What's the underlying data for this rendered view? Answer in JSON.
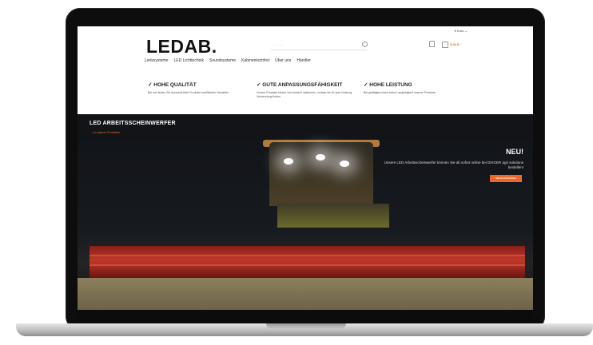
{
  "header": {
    "language": "€ Euro ⌄",
    "logo": "LEDAB.",
    "search_placeholder": "…………",
    "cart_total": "0,00 €*"
  },
  "nav": {
    "items": [
      "Lenksysteme",
      "LED Lichttechnik",
      "Soundsysteme",
      "Kabinenkomfort",
      "Über uns",
      "Händler"
    ]
  },
  "features": [
    {
      "title": "✓ HOHE QUALITÄT",
      "text": "Bei uns finden Sie ausschließlich Produkte zertifizierter Hersteller"
    },
    {
      "title": "✓ GUTE ANPASSUNGSFÄHIGKEIT",
      "text": "Unsere Produkte lassen sich einfach optimieren, sodass sie für jede Nutzung Verwendung finden"
    },
    {
      "title": "✓ HOHE LEISTUNG",
      "text": "Bei getätigtem kann keine Langlebigkeit unserer Produkte"
    }
  ],
  "hero": {
    "title": "LED ARBEITSSCHEINWERFER",
    "link": "zu unseren Produkten",
    "badge": "NEU!",
    "text": "Unsere LED Arbeitsscheinwerfer können Sie ab sofort online bei DIXGER agri solutions bestellen!",
    "button": "MEHR ERFAHREN"
  },
  "colors": {
    "accent": "#e8692a",
    "hero_bg": "#111317",
    "harvester_red": "#c0392b"
  }
}
